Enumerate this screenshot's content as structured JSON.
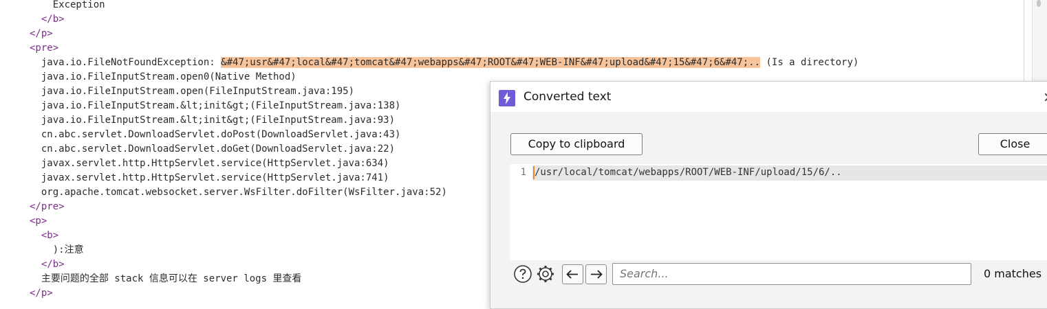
{
  "code_lines": [
    {
      "text": "    Exception",
      "kind": "text"
    },
    {
      "text": "  </b>",
      "kind": "tag"
    },
    {
      "text": "</p>",
      "kind": "tag"
    },
    {
      "text": "<pre>",
      "kind": "tag"
    },
    {
      "prefix": "  java.io.FileNotFoundException: ",
      "highlight": "&#47;usr&#47;local&#47;tomcat&#47;webapps&#47;ROOT&#47;WEB-INF&#47;upload&#47;15&#47;6&#47;..",
      "suffix": " (Is a directory)",
      "kind": "highlight"
    },
    {
      "text": "  java.io.FileInputStream.open0(Native Method)",
      "kind": "text"
    },
    {
      "text": "  java.io.FileInputStream.open(FileInputStream.java:195)",
      "kind": "text"
    },
    {
      "text": "  java.io.FileInputStream.&lt;init&gt;(FileInputStream.java:138)",
      "kind": "text"
    },
    {
      "text": "  java.io.FileInputStream.&lt;init&gt;(FileInputStream.java:93)",
      "kind": "text"
    },
    {
      "text": "  cn.abc.servlet.DownloadServlet.doPost(DownloadServlet.java:43)",
      "kind": "text"
    },
    {
      "text": "  cn.abc.servlet.DownloadServlet.doGet(DownloadServlet.java:22)",
      "kind": "text"
    },
    {
      "text": "  javax.servlet.http.HttpServlet.service(HttpServlet.java:634)",
      "kind": "text"
    },
    {
      "text": "  javax.servlet.http.HttpServlet.service(HttpServlet.java:741)",
      "kind": "text"
    },
    {
      "text": "  org.apache.tomcat.websocket.server.WsFilter.doFilter(WsFilter.java:52)",
      "kind": "text"
    },
    {
      "text": "</pre>",
      "kind": "tag"
    },
    {
      "text": "<p>",
      "kind": "tag"
    },
    {
      "text": "  <b>",
      "kind": "tag"
    },
    {
      "text": "    ):注意",
      "kind": "text"
    },
    {
      "text": "  </b>",
      "kind": "tag"
    },
    {
      "text": "  主要问题的全部 stack 信息可以在 server logs 里查看",
      "kind": "text"
    },
    {
      "text": "</p>",
      "kind": "tag"
    }
  ],
  "dialog": {
    "title": "Converted text",
    "copy_label": "Copy to clipboard",
    "close_label": "Close",
    "close_icon": "×",
    "line_number": "1",
    "converted_text": "/usr/local/tomcat/webapps/ROOT/WEB-INF/upload/15/6/..",
    "search_placeholder": "Search...",
    "search_value": "",
    "matches_label": "0 matches"
  },
  "colors": {
    "tag": "#7d2d8c",
    "highlight": "#f7c39a",
    "accent": "#6f5bd6",
    "cursor": "#e8872c"
  },
  "icons": [
    "bolt-icon",
    "help-icon",
    "gear-icon",
    "arrow-left-icon",
    "arrow-right-icon"
  ]
}
